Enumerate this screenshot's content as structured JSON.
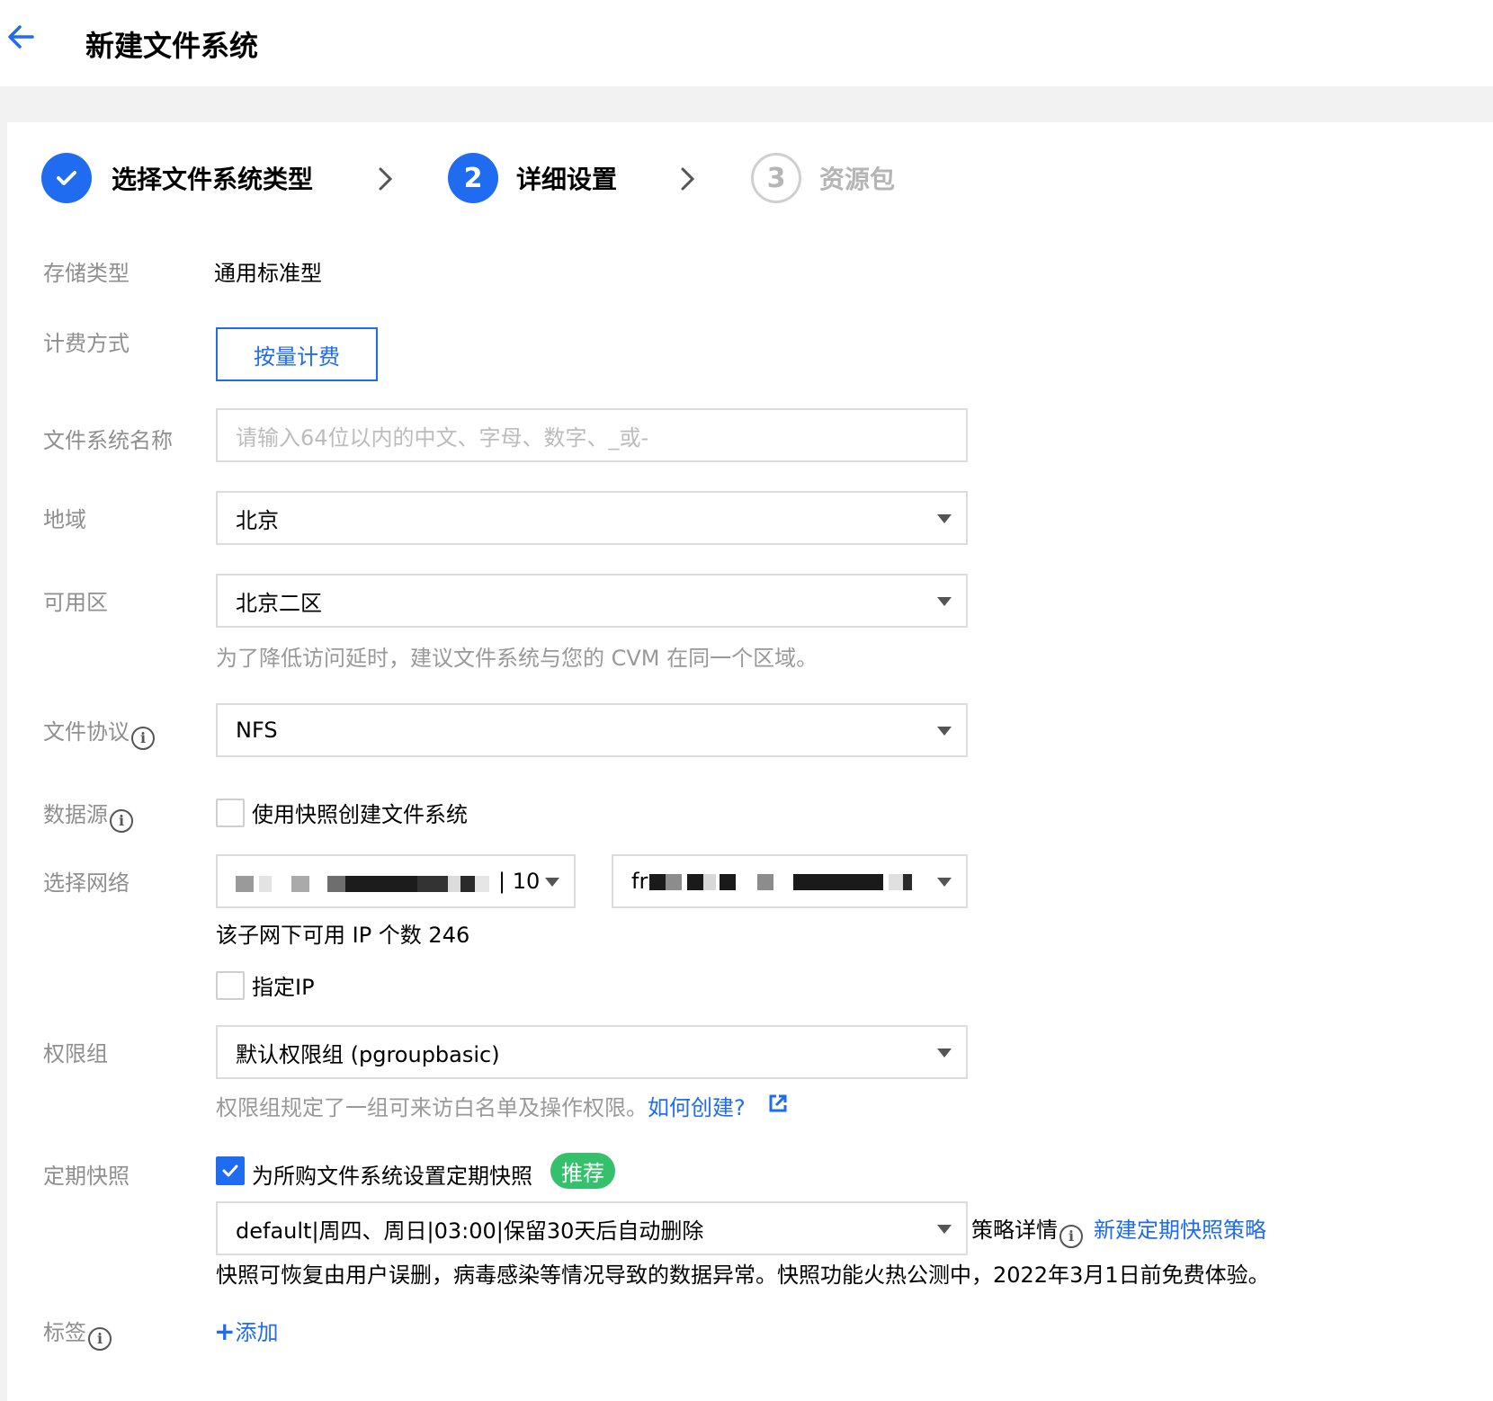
{
  "header": {
    "title": "新建文件系统"
  },
  "steps": [
    {
      "label": "选择文件系统类型",
      "state": "done"
    },
    {
      "number": "2",
      "label": "详细设置",
      "state": "active"
    },
    {
      "number": "3",
      "label": "资源包",
      "state": "idle"
    }
  ],
  "form": {
    "storage_type": {
      "label": "存储类型",
      "value": "通用标准型"
    },
    "billing": {
      "label": "计费方式",
      "option": "按量计费"
    },
    "fs_name": {
      "label": "文件系统名称",
      "placeholder": "请输入64位以内的中文、字母、数字、_或-"
    },
    "region": {
      "label": "地域",
      "value": "北京"
    },
    "zone": {
      "label": "可用区",
      "value": "北京二区",
      "hint": "为了降低访问延时，建议文件系统与您的 CVM 在同一个区域。"
    },
    "protocol": {
      "label": "文件协议",
      "value": "NFS"
    },
    "datasource": {
      "label": "数据源",
      "checkbox": "使用快照创建文件系统",
      "checked": false
    },
    "network": {
      "label": "选择网络",
      "vpc_suffix": "| 10",
      "subnet_prefix": "fra",
      "ip_info": "该子网下可用 IP 个数 246",
      "specify_ip": "指定IP",
      "specify_ip_checked": false
    },
    "permission": {
      "label": "权限组",
      "value": "默认权限组 (pgroupbasic)",
      "hint": "权限组规定了一组可来访白名单及操作权限。",
      "link": "如何创建?"
    },
    "snapshot": {
      "label": "定期快照",
      "checkbox": "为所购文件系统设置定期快照",
      "checked": true,
      "badge": "推荐",
      "policy": "default|周四、周日|03:00|保留30天后自动删除",
      "policy_detail": "策略详情",
      "new_policy": "新建定期快照策略",
      "note": "快照可恢复由用户误删，病毒感染等情况导致的数据异常。快照功能火热公测中，2022年3月1日前免费体验。"
    },
    "tags": {
      "label": "标签",
      "add": "添加"
    }
  },
  "colors": {
    "accent": "#1f6cf0",
    "badge": "#35c06b",
    "label": "#8f8f8f",
    "hint": "#999999"
  }
}
